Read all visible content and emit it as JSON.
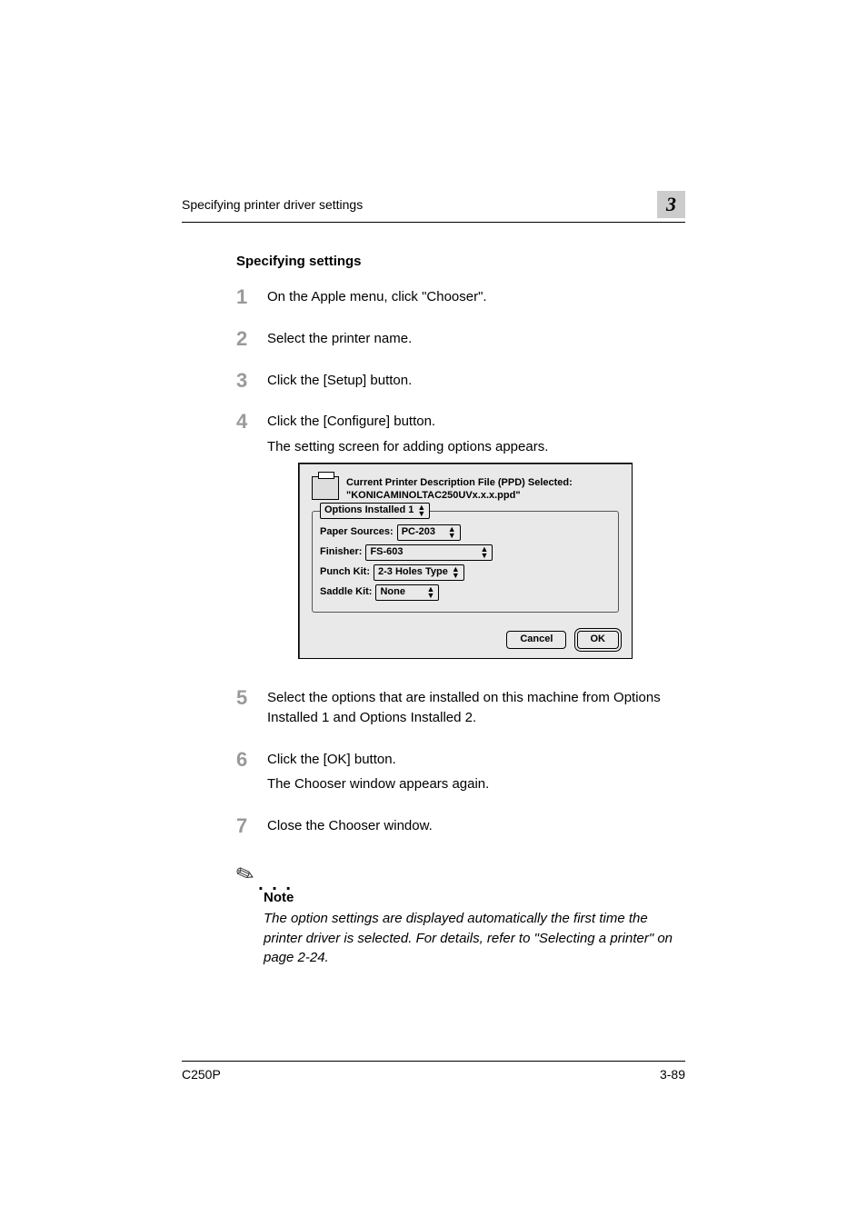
{
  "header": {
    "running_title": "Specifying printer driver settings",
    "chapter_number": "3"
  },
  "section": {
    "heading": "Specifying settings"
  },
  "steps": [
    {
      "n": "1",
      "text": "On the Apple menu, click \"Chooser\"."
    },
    {
      "n": "2",
      "text": "Select the printer name."
    },
    {
      "n": "3",
      "text": "Click the [Setup] button."
    },
    {
      "n": "4",
      "text": "Click the [Configure] button.",
      "extra": "The setting screen for adding options appears."
    },
    {
      "n": "5",
      "text": "Select the options that are installed on this machine from Options Installed 1 and Options Installed 2."
    },
    {
      "n": "6",
      "text": "Click the [OK] button.",
      "extra": "The Chooser window appears again."
    },
    {
      "n": "7",
      "text": "Close the Chooser window."
    }
  ],
  "dialog": {
    "ppd_line1": "Current Printer Description File (PPD) Selected:",
    "ppd_line2": "\"KONICAMINOLTAC250UVx.x.x.ppd\"",
    "group_legend": "Options Installed 1",
    "paper_sources_label": "Paper Sources:",
    "paper_sources_value": "PC-203",
    "finisher_label": "Finisher:",
    "finisher_value": "FS-603",
    "punch_label": "Punch Kit:",
    "punch_value": "2-3 Holes Type",
    "saddle_label": "Saddle Kit:",
    "saddle_value": "None",
    "cancel": "Cancel",
    "ok": "OK"
  },
  "note": {
    "label": "Note",
    "text": "The option settings are displayed automatically the first time the printer driver is selected. For details, refer to \"Selecting a printer\" on page 2-24."
  },
  "footer": {
    "model": "C250P",
    "page": "3-89"
  },
  "chart_data": {
    "type": "table",
    "title": "Printer configuration dialog values",
    "rows": [
      {
        "field": "Options group",
        "value": "Options Installed 1"
      },
      {
        "field": "Paper Sources",
        "value": "PC-203"
      },
      {
        "field": "Finisher",
        "value": "FS-603"
      },
      {
        "field": "Punch Kit",
        "value": "2-3 Holes Type"
      },
      {
        "field": "Saddle Kit",
        "value": "None"
      }
    ]
  }
}
